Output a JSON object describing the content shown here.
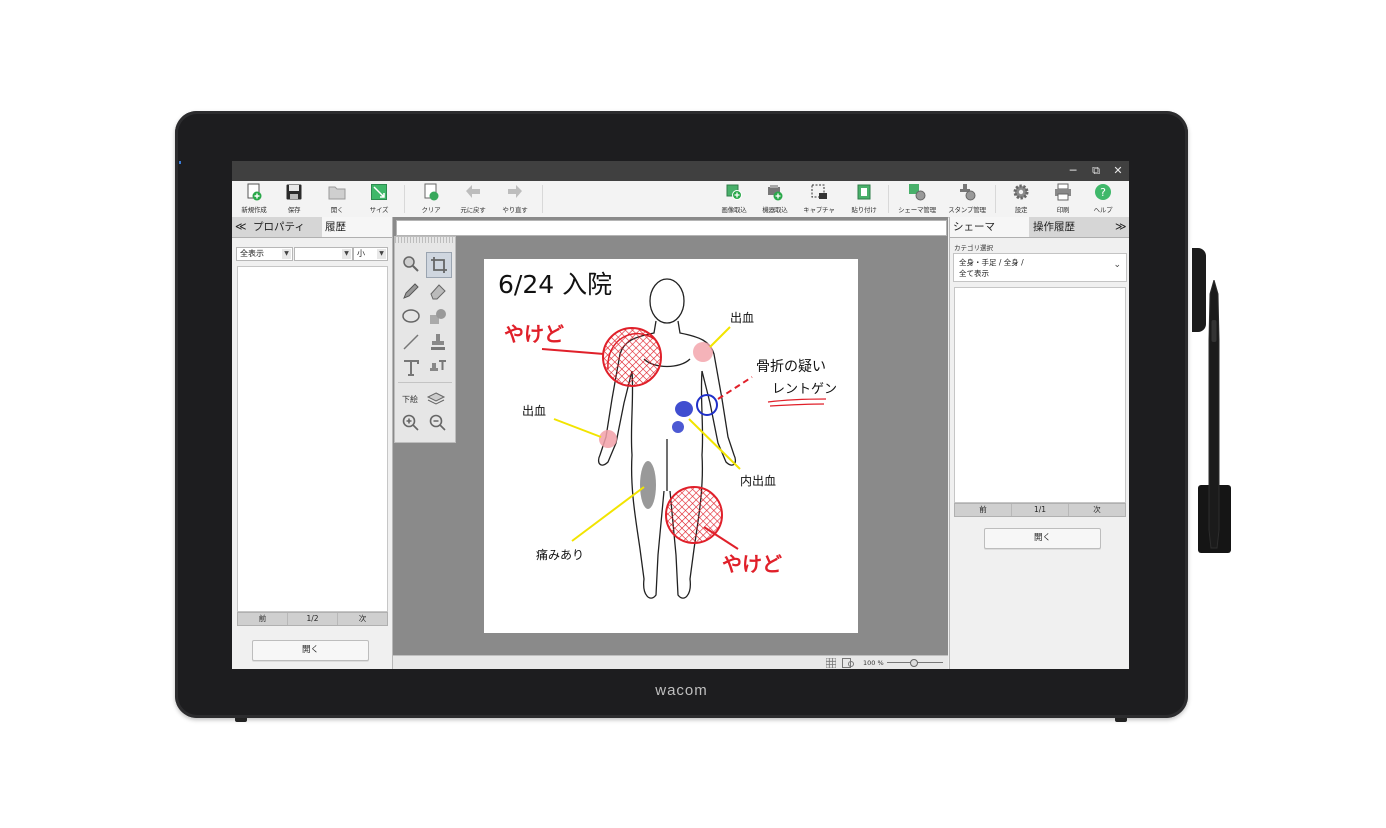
{
  "device": {
    "brand": "wacom"
  },
  "window": {
    "minimize": "─",
    "restore": "⧉",
    "close": "✕"
  },
  "toolbar": {
    "left": [
      {
        "label": "新規作成",
        "icon": "new-document-icon"
      },
      {
        "label": "保存",
        "icon": "save-icon"
      },
      {
        "label": "開く",
        "icon": "open-folder-icon"
      },
      {
        "label": "サイズ",
        "icon": "resize-icon"
      }
    ],
    "edit": [
      {
        "label": "クリア",
        "icon": "clear-icon"
      },
      {
        "label": "元に戻す",
        "icon": "undo-icon"
      },
      {
        "label": "やり直す",
        "icon": "redo-icon"
      }
    ],
    "right": [
      {
        "label": "画像取込",
        "icon": "image-import-icon"
      },
      {
        "label": "機器取込",
        "icon": "device-import-icon"
      },
      {
        "label": "キャプチャ",
        "icon": "capture-icon"
      },
      {
        "label": "貼り付け",
        "icon": "paste-icon"
      },
      {
        "label": "シェーマ管理",
        "icon": "schema-manage-icon"
      },
      {
        "label": "スタンプ管理",
        "icon": "stamp-manage-icon"
      },
      {
        "label": "設定",
        "icon": "settings-gear-icon"
      },
      {
        "label": "印刷",
        "icon": "print-icon"
      },
      {
        "label": "ヘルプ",
        "icon": "help-icon"
      }
    ]
  },
  "left_panel": {
    "collapse": "≪",
    "tabs": [
      "プロパティ",
      "履歴"
    ],
    "filter": {
      "value": "全表示",
      "second": "",
      "size": "小"
    },
    "pager": {
      "prev": "前",
      "page": "1/2",
      "next": "次"
    },
    "open_button": "開く"
  },
  "tools": {
    "underlay_label": "下絵"
  },
  "canvas": {
    "header": "6/24 入院",
    "annotations": {
      "burn_left": "やけど",
      "bleeding_shoulder": "出血",
      "fracture": "骨折の疑い",
      "xray": "レントゲン",
      "bleeding_wrist": "出血",
      "internal_bleeding": "内出血",
      "pain": "痛みあり",
      "burn_right": "やけど"
    },
    "colors": {
      "red": "#e0202a",
      "blue": "#1f2fc8",
      "yellow": "#f2e400"
    }
  },
  "statusbar": {
    "zoom": "100 %"
  },
  "right_panel": {
    "collapse": "≫",
    "tabs": [
      "シェーマ",
      "操作履歴"
    ],
    "category_label": "カテゴリ選択",
    "category_value_1": "全身・手足 / 全身 /",
    "category_value_2": "全て表示",
    "pager": {
      "prev": "前",
      "page": "1/1",
      "next": "次"
    },
    "open_button": "開く"
  }
}
